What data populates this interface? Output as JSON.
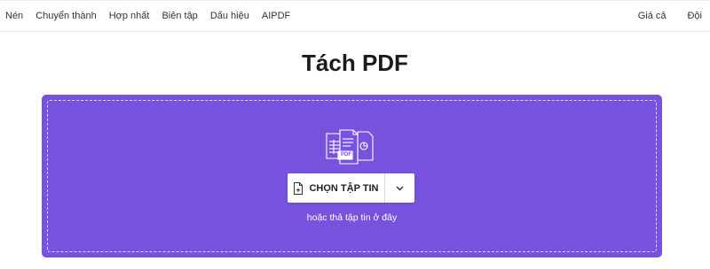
{
  "nav": {
    "left_items": [
      "Nén",
      "Chuyển thành",
      "Hợp nhất",
      "Biên tập",
      "Dấu hiệu",
      "AIPDF"
    ],
    "right_items": [
      "Giá cả",
      "Đội"
    ]
  },
  "main": {
    "title": "Tách PDF",
    "choose_button_label": "CHỌN TẬP TIN",
    "drop_hint": "hoặc thả tập tin ở đây",
    "graphic_label": "PDF"
  },
  "icons": {
    "file_graphic": "split-files-icon",
    "choose_button": "file-plus-icon",
    "dropdown": "chevron-down-icon"
  },
  "colors": {
    "dropzone": "#7752dc",
    "button_bg": "#ffffff"
  }
}
